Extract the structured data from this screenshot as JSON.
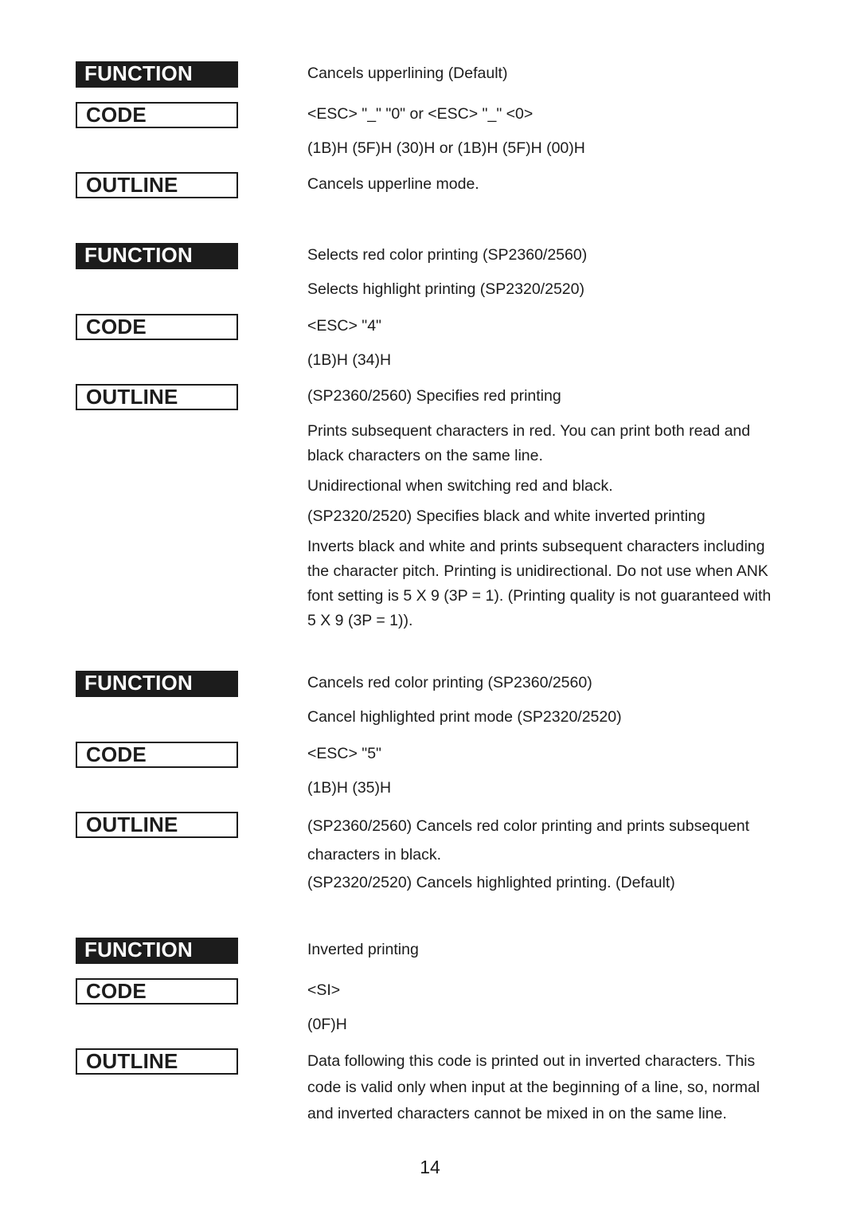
{
  "labels": {
    "function": "FUNCTION",
    "code": "CODE",
    "outline": "OUTLINE"
  },
  "entries": [
    {
      "function": [
        "Cancels upperlining (Default)"
      ],
      "code": [
        "<ESC> \"_\" \"0\" or <ESC> \"_\" <0>",
        "(1B)H (5F)H (30)H or (1B)H (5F)H (00)H"
      ],
      "outline": [
        "Cancels upperline mode."
      ]
    },
    {
      "function": [
        "Selects red color printing (SP2360/2560)",
        "Selects highlight printing (SP2320/2520)"
      ],
      "code": [
        "<ESC> \"4\"",
        "(1B)H (34)H"
      ],
      "outline": [
        "(SP2360/2560) Specifies red printing",
        "Prints subsequent characters in red.  You can print both read and black characters on the same line.",
        "Unidirectional when switching red and black.",
        "(SP2320/2520) Specifies black and white inverted printing",
        "Inverts black and white and prints subsequent characters including the character pitch.  Printing is unidirectional.  Do not use when ANK font setting is 5 X 9 (3P = 1).  (Printing quality is not guaranteed with 5 X 9 (3P = 1))."
      ]
    },
    {
      "function": [
        "Cancels red color printing (SP2360/2560)",
        "Cancel highlighted print mode (SP2320/2520)"
      ],
      "code": [
        "<ESC> \"5\"",
        "(1B)H (35)H"
      ],
      "outline": [
        "(SP2360/2560) Cancels red color printing and prints subsequent characters in black.",
        "(SP2320/2520) Cancels highlighted printing.  (Default)"
      ]
    },
    {
      "function": [
        "Inverted printing"
      ],
      "code": [
        "<SI>",
        "(0F)H"
      ],
      "outline": [
        "Data following this code is printed out in inverted characters. This code is valid only when input at the beginning of a line, so, normal and inverted characters cannot be mixed in on the same line."
      ]
    }
  ],
  "page_number": "14"
}
